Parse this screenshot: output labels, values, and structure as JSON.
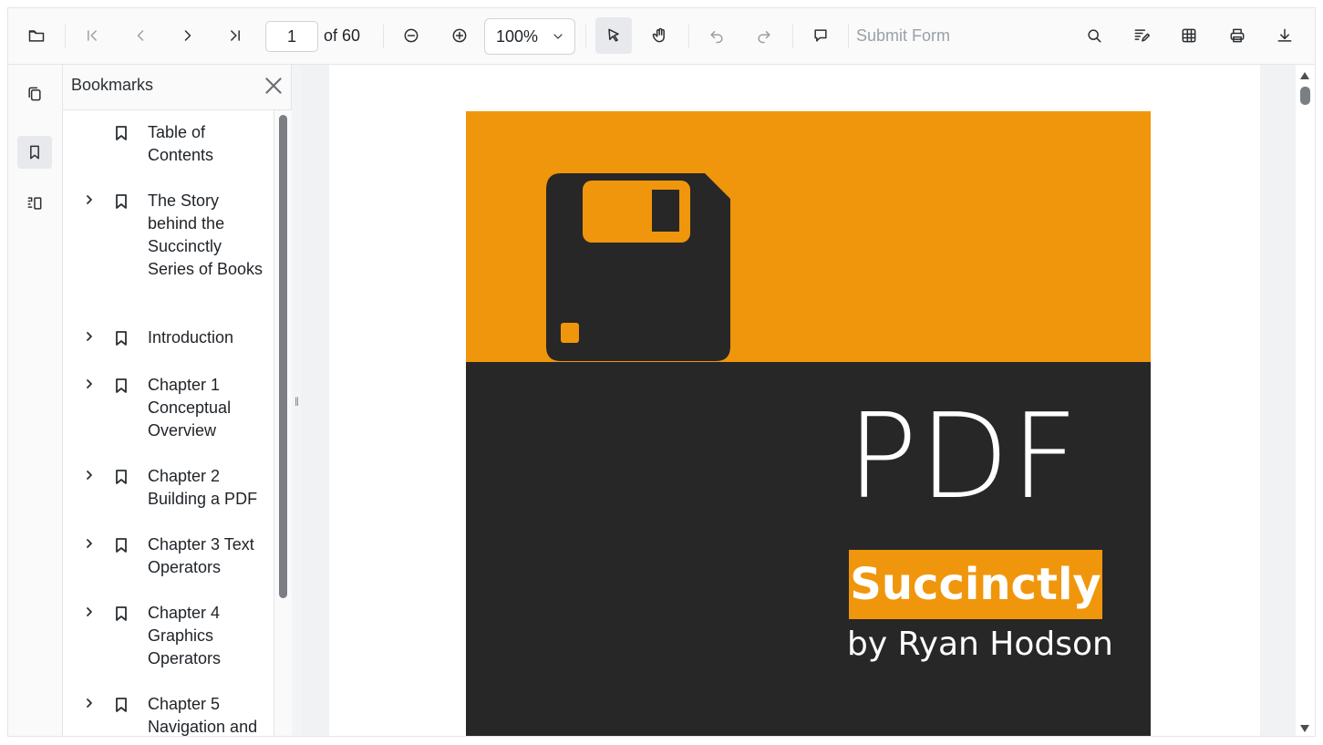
{
  "toolbar": {
    "open": "open-file",
    "page_current": "1",
    "page_total_text": "of 60",
    "zoom": "100%",
    "submit_form": "Submit Form"
  },
  "bookmarks": {
    "title": "Bookmarks",
    "items": [
      {
        "label": "Table of Contents",
        "expandable": false
      },
      {
        "label": "The Story behind the Succinctly Series of Books",
        "expandable": true
      },
      {
        "label": "Introduction",
        "expandable": true
      },
      {
        "label": "Chapter 1 Conceptual Overview",
        "expandable": true
      },
      {
        "label": "Chapter 2 Building a PDF",
        "expandable": true
      },
      {
        "label": "Chapter 3 Text Operators",
        "expandable": true
      },
      {
        "label": "Chapter 4 Graphics Operators",
        "expandable": true
      },
      {
        "label": "Chapter 5 Navigation and",
        "expandable": true
      }
    ]
  },
  "cover": {
    "big_text": "PDF",
    "brand": "Succinctly",
    "author": "by Ryan Hodson",
    "colors": {
      "orange": "#f0960c",
      "dark": "#272727"
    }
  },
  "colors": {
    "accent": "#f0960c",
    "disabled": "#9aa0a6",
    "active_bg": "#e7e9ec"
  }
}
